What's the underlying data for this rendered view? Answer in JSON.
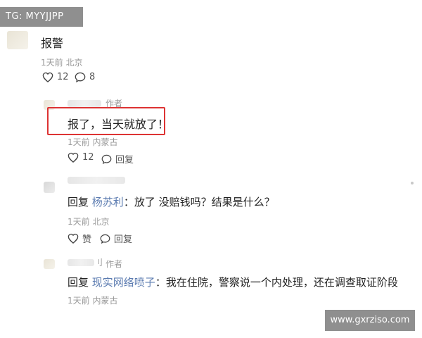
{
  "watermark_top": "TG: MYYJJPP",
  "watermark_bottom": "www.gxrziso.com",
  "comment": {
    "text": "报警",
    "meta": "1天前 北京",
    "likes": "12",
    "replies": "8"
  },
  "reply1": {
    "author_tag": "作者",
    "text": "报了，当天就放了！",
    "meta": "1天前 内蒙古",
    "likes": "12",
    "reply_label": "回复"
  },
  "reply2": {
    "prefix": "回复",
    "target": "杨苏利",
    "text": "：放了 没赔钱吗？结果是什么？",
    "meta": "1天前 北京",
    "like_label": "赞",
    "reply_label": "回复"
  },
  "reply3": {
    "name_suffix": "刂",
    "author_tag": "作者",
    "prefix": "回复",
    "target": "现实网络喷子",
    "text": "：我在住院，警察说一个内处理，还在调查取证阶段",
    "meta": "1天前 内蒙古"
  },
  "colors": {
    "highlight": "#dd3333",
    "reply_target": "#5b7bb0",
    "watermark_bg": "#8f8f8f"
  }
}
